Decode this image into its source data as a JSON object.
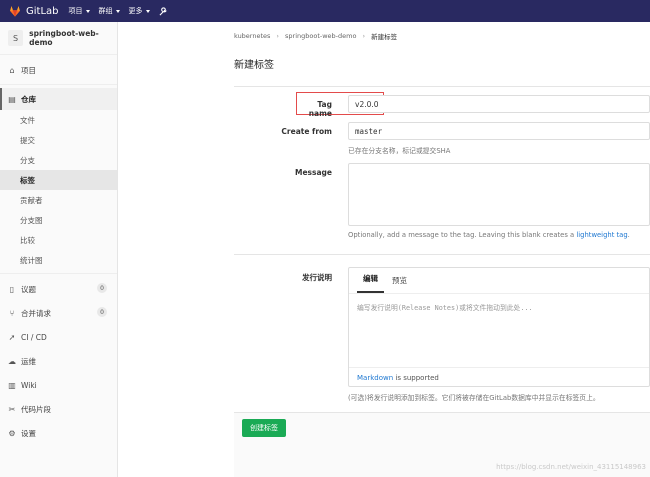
{
  "topbar": {
    "brand": "GitLab",
    "nav": [
      "项目",
      "群组",
      "更多"
    ]
  },
  "sidebar": {
    "project_initial": "S",
    "project_name": "springboot-web-demo",
    "items_top": [
      {
        "label": "项目",
        "icon": "home-icon"
      }
    ],
    "repo": {
      "label": "仓库",
      "icon": "document-icon"
    },
    "repo_sub": [
      "文件",
      "提交",
      "分支",
      "标签",
      "贡献者",
      "分支图",
      "比较",
      "统计图"
    ],
    "current_sub": "标签",
    "items_bottom": [
      {
        "label": "议题",
        "icon": "issues-icon",
        "badge": "0"
      },
      {
        "label": "合并请求",
        "icon": "merge-request-icon",
        "badge": "0"
      },
      {
        "label": "CI / CD",
        "icon": "rocket-icon",
        "badge": ""
      },
      {
        "label": "运维",
        "icon": "cloud-icon",
        "badge": ""
      },
      {
        "label": "Wiki",
        "icon": "book-icon",
        "badge": ""
      },
      {
        "label": "代码片段",
        "icon": "scissors-icon",
        "badge": ""
      },
      {
        "label": "设置",
        "icon": "gear-icon",
        "badge": ""
      }
    ]
  },
  "breadcrumb": [
    "kubernetes",
    "springboot-web-demo",
    "新建标签"
  ],
  "page_title": "新建标签",
  "form": {
    "tag_name_label": "Tag name",
    "tag_name_value": "v2.0.0",
    "create_from_label": "Create from",
    "create_from_value": "master",
    "create_from_help": "已存在分支名称，标记或提交SHA",
    "message_label": "Message",
    "message_help_prefix": "Optionally, add a message to the tag. Leaving this blank creates a ",
    "message_help_link": "lightweight tag",
    "message_help_suffix": ".",
    "release_label": "发行说明",
    "release_tabs": [
      "编辑",
      "预览"
    ],
    "release_placeholder": "编写发行说明(Release Notes)或将文件拖动到此处...",
    "markdown_link": "Markdown",
    "markdown_suffix": " is supported",
    "release_help": "(可选)将发行说明添加到标签。它们将被存储在GitLab数据库中并显示在标签页上。",
    "submit_label": "创建标签"
  },
  "watermark": "https://blog.csdn.net/weixin_43115148963"
}
